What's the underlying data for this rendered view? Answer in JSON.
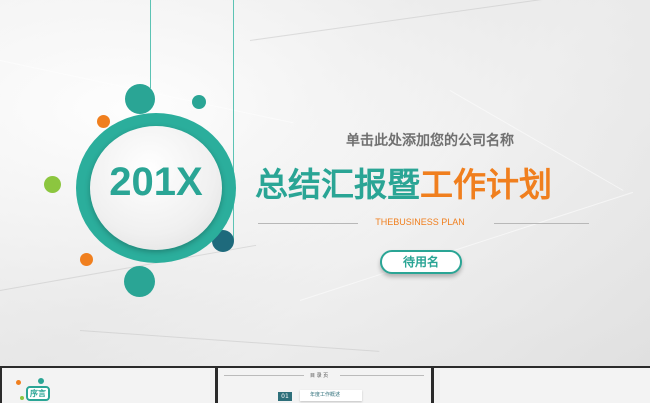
{
  "slide": {
    "year": "201X",
    "company": "单击此处添加您的公司名称",
    "title_part1": "总结汇报暨",
    "title_part2": "工作计划",
    "subtitle": "THEBUSINESS PLAN",
    "button": "待用名"
  },
  "thumbnails": {
    "thumb1_label": "序言",
    "thumb2_title": "目 录 页",
    "thumb2_num": "01",
    "thumb2_item": "年度工作概述"
  },
  "colors": {
    "teal": "#2aa595",
    "orange": "#f07f1e",
    "dark_teal": "#1e6a7c",
    "green": "#8cc63f"
  }
}
